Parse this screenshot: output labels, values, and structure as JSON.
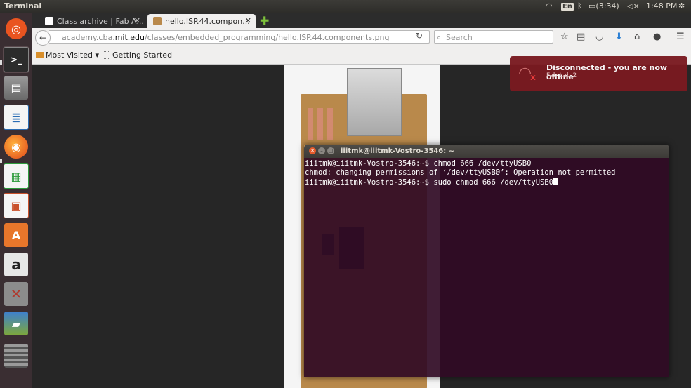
{
  "topbar": {
    "app_name": "Terminal",
    "keyboard_layout": "En",
    "battery": "(3:34)",
    "clock": "1:48 PM"
  },
  "launcher": {
    "items": [
      {
        "name": "ubuntu-dash",
        "color": "#e95420"
      },
      {
        "name": "terminal",
        "color": "#2c2c2c"
      },
      {
        "name": "files",
        "color": "#8a8a8a"
      },
      {
        "name": "libreoffice-writer",
        "color": "#2a6db5"
      },
      {
        "name": "firefox",
        "color": "#e76f15"
      },
      {
        "name": "libreoffice-calc",
        "color": "#2e9b3c"
      },
      {
        "name": "libreoffice-impress",
        "color": "#c9502a"
      },
      {
        "name": "software-center",
        "color": "#e8762b"
      },
      {
        "name": "amazon",
        "color": "#d9d9d9"
      },
      {
        "name": "system-settings",
        "color": "#b03a2e"
      },
      {
        "name": "backups",
        "color": "#7ea83a"
      },
      {
        "name": "workspaces",
        "color": "#555555"
      }
    ]
  },
  "browser": {
    "tabs": [
      {
        "label": "Class archive | Fab A...",
        "active": false
      },
      {
        "label": "hello.ISP.44.compon...",
        "active": true
      }
    ],
    "url_prefix": "academy.cba.",
    "url_domain": "mit.edu",
    "url_path": "/classes/embedded_programming/hello.ISP.44.components.png",
    "search_placeholder": "Search",
    "bookmarks": [
      {
        "label": "Most Visited ▾"
      },
      {
        "label": "Getting Started"
      }
    ]
  },
  "notification": {
    "title": "Disconnected - you are now offline",
    "body": "Fab Lab 2"
  },
  "terminal": {
    "title": "iiitmk@iiitmk-Vostro-3546: ~",
    "lines": [
      "iiitmk@iiitmk-Vostro-3546:~$ chmod 666 /dev/ttyUSB0",
      "chmod: changing permissions of ‘/dev/ttyUSB0’: Operation not permitted",
      "iiitmk@iiitmk-Vostro-3546:~$ sudo chmod 666 /dev/ttyUSB0"
    ]
  }
}
